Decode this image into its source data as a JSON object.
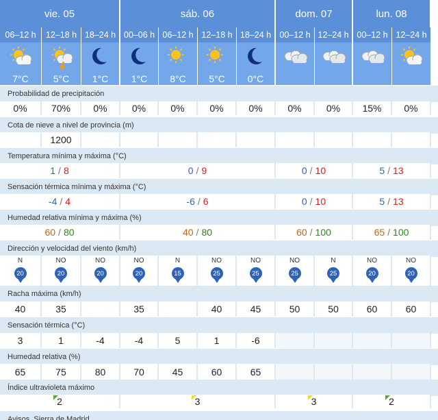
{
  "days": [
    {
      "label": "vie. 05"
    },
    {
      "label": "sáb. 06"
    },
    {
      "label": "dom. 07"
    },
    {
      "label": "lun. 08"
    }
  ],
  "slots": [
    {
      "time": "06–12 h",
      "sky": "sun-cloud-icon",
      "temp": "7°C"
    },
    {
      "time": "12–18 h",
      "sky": "storm-sun-cloud-icon",
      "temp": "5°C"
    },
    {
      "time": "18–24 h",
      "sky": "moon-icon",
      "temp": "1°C"
    },
    {
      "time": "00–06 h",
      "sky": "moon-icon",
      "temp": "1°C"
    },
    {
      "time": "06–12 h",
      "sky": "sun-icon",
      "temp": "8°C"
    },
    {
      "time": "12–18 h",
      "sky": "sun-icon",
      "temp": "5°C"
    },
    {
      "time": "18–24 h",
      "sky": "moon-icon",
      "temp": "0°C"
    },
    {
      "time": "00–12 h",
      "sky": "clouds-icon",
      "temp": ""
    },
    {
      "time": "12–24 h",
      "sky": "clouds-icon",
      "temp": ""
    },
    {
      "time": "00–12 h",
      "sky": "clouds-icon",
      "temp": ""
    },
    {
      "time": "12–24 h",
      "sky": "sun-cloud-icon",
      "temp": ""
    }
  ],
  "labels": {
    "precip": "Probabilidad de precipitación",
    "snow": "Cota de nieve a nivel de provincia (m)",
    "temp": "Temperatura mínima y máxima (°C)",
    "feels": "Sensación térmica mínima y máxima (°C)",
    "humid": "Humedad relativa mínima y máxima (%)",
    "wind": "Dirección y velocidad del viento (km/h)",
    "gust": "Racha máxima (km/h)",
    "feels_hour": "Sensación térmica (°C)",
    "humid_hour": "Humedad relativa (%)",
    "uv": "Índice ultravioleta máximo",
    "avisos": "Avisos. Sierra de Madrid"
  },
  "precip": [
    "0%",
    "70%",
    "0%",
    "0%",
    "0%",
    "0%",
    "0%",
    "0%",
    "0%",
    "15%",
    "0%"
  ],
  "snow": [
    "",
    "1200",
    "",
    "",
    "",
    "",
    "",
    "",
    "",
    "",
    ""
  ],
  "temp": [
    {
      "min": "1",
      "max": "8"
    },
    {
      "min": "0",
      "max": "9"
    },
    {
      "min": "0",
      "max": "10"
    },
    {
      "min": "5",
      "max": "13"
    }
  ],
  "feels": [
    {
      "min": "-4",
      "max": "4"
    },
    {
      "min": "-6",
      "max": "6"
    },
    {
      "min": "0",
      "max": "10"
    },
    {
      "min": "5",
      "max": "13"
    }
  ],
  "humid": [
    {
      "min": "60",
      "max": "80"
    },
    {
      "min": "40",
      "max": "80"
    },
    {
      "min": "60",
      "max": "100"
    },
    {
      "min": "65",
      "max": "100"
    }
  ],
  "wind": [
    {
      "dir": "N",
      "speed": "20"
    },
    {
      "dir": "NO",
      "speed": "20"
    },
    {
      "dir": "NO",
      "speed": "20"
    },
    {
      "dir": "NO",
      "speed": "20"
    },
    {
      "dir": "N",
      "speed": "15"
    },
    {
      "dir": "NO",
      "speed": "25"
    },
    {
      "dir": "NO",
      "speed": "25"
    },
    {
      "dir": "NO",
      "speed": "25"
    },
    {
      "dir": "N",
      "speed": "25"
    },
    {
      "dir": "NO",
      "speed": "20"
    },
    {
      "dir": "NO",
      "speed": "20"
    }
  ],
  "gust": [
    "40",
    "35",
    "",
    "35",
    "",
    "40",
    "45",
    "50",
    "50",
    "60",
    "60"
  ],
  "feels_hour": [
    "3",
    "1",
    "-4",
    "-4",
    "5",
    "1",
    "-6"
  ],
  "humid_hour": [
    "65",
    "75",
    "80",
    "70",
    "45",
    "60",
    "65"
  ],
  "uv": [
    {
      "value": "2",
      "color": "#4caf30"
    },
    {
      "value": "3",
      "color": "#f0e020"
    },
    {
      "value": "3",
      "color": "#f0e020"
    },
    {
      "value": "2",
      "color": "#4caf30"
    }
  ]
}
